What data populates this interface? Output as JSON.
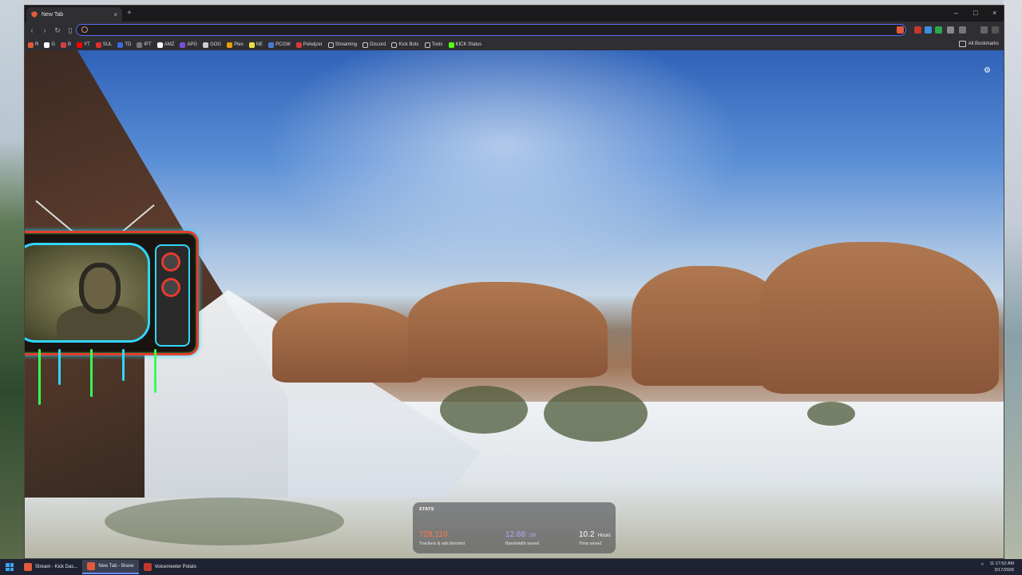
{
  "browser": {
    "tab": {
      "title": "New Tab",
      "close": "×"
    },
    "new_tab_label": "+",
    "window_controls": {
      "minimize": "–",
      "maximize": "□",
      "close": "×"
    },
    "address": {
      "value": ""
    }
  },
  "bookmarks": {
    "items": [
      {
        "label": "R",
        "color": "#e25a3a"
      },
      {
        "label": "G",
        "color": "#ffffff"
      },
      {
        "label": "B",
        "color": "#d04040"
      },
      {
        "label": "YT",
        "color": "#ff0000"
      },
      {
        "label": "SUL",
        "color": "#e03030"
      },
      {
        "label": "TD",
        "color": "#3a6bd8"
      },
      {
        "label": "IPT",
        "color": "#777777"
      },
      {
        "label": "AMZ",
        "color": "#ffffff"
      },
      {
        "label": "APG",
        "color": "#7a4fd8"
      },
      {
        "label": "GOG",
        "color": "#cccccc"
      },
      {
        "label": "Plex",
        "color": "#e5a00d"
      },
      {
        "label": "NE",
        "color": "#f0e040"
      },
      {
        "label": "PCGW",
        "color": "#4a7ad8"
      },
      {
        "label": "Polwijzer",
        "color": "#d83a3a"
      },
      {
        "label": "Streaming",
        "color": "folder"
      },
      {
        "label": "Discord",
        "color": "folder"
      },
      {
        "label": "Kick Bots",
        "color": "folder"
      },
      {
        "label": "Tools",
        "color": "folder"
      },
      {
        "label": "KICK Status",
        "color": "#53fc18"
      }
    ],
    "all_bookmarks": "All Bookmarks"
  },
  "stats": {
    "title": "STATS",
    "trackers": {
      "value": "728,110",
      "label": "Trackers & ads blocked",
      "color": "#ff7a4a"
    },
    "bandwidth": {
      "value": "12.68",
      "unit": "GB",
      "label": "Bandwidth saved",
      "color": "#b8a6ff"
    },
    "time": {
      "value": "10.2",
      "unit": "Hours",
      "label": "Time saved",
      "color": "#ffffff"
    }
  },
  "taskbar": {
    "items": [
      {
        "label": "Stream - Kick Das...",
        "icon_color": "#e25a3a",
        "active": false
      },
      {
        "label": "New Tab - Brave",
        "icon_color": "#e25a3a",
        "active": true
      },
      {
        "label": "Voicemeeter Potato",
        "icon_color": "#c0392b",
        "active": false
      }
    ],
    "clock": {
      "time": "11:17:52 AM",
      "date": "3/17/2026"
    }
  }
}
